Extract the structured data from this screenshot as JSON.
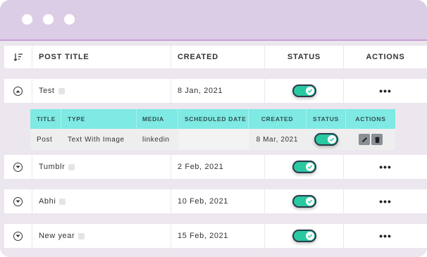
{
  "table": {
    "headers": {
      "post_title": "POST TITLE",
      "created": "CREATED",
      "status": "STATUS",
      "actions": "ACTIONS"
    },
    "rows": [
      {
        "title": "Test",
        "created": "8 Jan, 2021",
        "status": true,
        "expanded": true
      },
      {
        "title": "Tumblr",
        "created": "2 Feb, 2021",
        "status": true,
        "expanded": false
      },
      {
        "title": "Abhi",
        "created": "10 Feb, 2021",
        "status": true,
        "expanded": false
      },
      {
        "title": "New year",
        "created": "15 Feb, 2021",
        "status": true,
        "expanded": false
      }
    ],
    "actions_label": "•••"
  },
  "subtable": {
    "headers": {
      "title": "TITLE",
      "type": "TYPE",
      "media": "MEDIA",
      "scheduled_date": "SCHEDULED DATE",
      "created": "CREATED",
      "status": "STATUS",
      "actions": "ACTIONS"
    },
    "row": {
      "title": "Post",
      "type": "Text With Image",
      "media": "linkedin",
      "scheduled_date": "",
      "created": "8 Mar, 2021",
      "status": true
    }
  },
  "colors": {
    "accent": "#29c9a1",
    "subheader": "#7fe9e3",
    "titlebar": "#dccde6"
  },
  "icons": [
    "sort-icon",
    "chevron-up-icon",
    "chevron-down-icon",
    "edit-icon",
    "check-icon",
    "more-icon",
    "pencil-icon",
    "trash-icon"
  ]
}
